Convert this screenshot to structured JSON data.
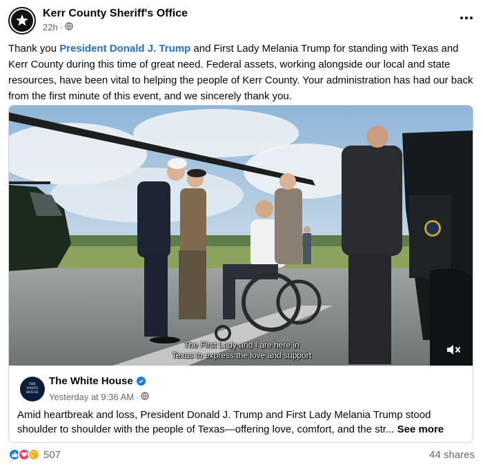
{
  "post": {
    "page_name": "Kerr County Sheriff's Office",
    "time": "22h",
    "audience_icon": "globe-icon",
    "text_before_mention": "Thank you ",
    "mention": "President Donald J. Trump",
    "text_after_mention": "  and First Lady Melania Trump for standing with Texas and Kerr County during this time of great need. Federal assets, working alongside our local and state resources, have been vital to helping the people of Kerr County. Your administration has had our back from the first minute of this event, and we sincerely thank you."
  },
  "video": {
    "caption_line1": "The First Lady and I are here in",
    "caption_line2": "Texas to express the love and support",
    "mute_icon": "speaker-muted-icon"
  },
  "shared": {
    "page_name": "The White House",
    "avatar_line1": "THE",
    "avatar_line2": "WHITE",
    "avatar_line3": "HOUSE",
    "time": "Yesterday at 9:36 AM",
    "text": "Amid heartbreak and loss, President Donald J. Trump and First Lady Melania Trump stood shoulder to shoulder with the people of Texas—offering love, comfort, and the str...",
    "see_more": "See more"
  },
  "footer": {
    "reaction_icons": [
      "like-icon",
      "love-icon",
      "care-icon"
    ],
    "reaction_count": "507",
    "shares": "44 shares"
  },
  "colors": {
    "mention": "#216fdb",
    "secondary_text": "#65676b",
    "like": "#1877f2",
    "love": "#f33e58",
    "care": "#f7b125"
  }
}
